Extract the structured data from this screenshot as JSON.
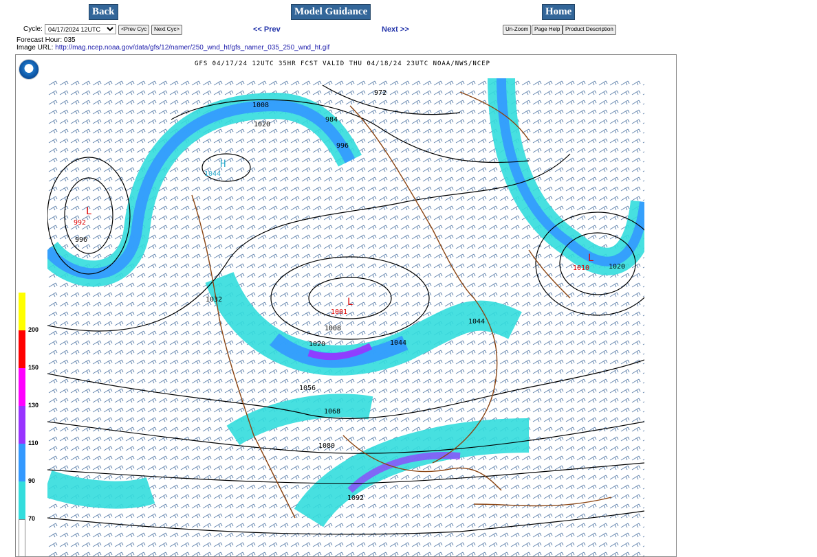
{
  "nav": {
    "back": "Back",
    "model_guidance": "Model Guidance",
    "home": "Home"
  },
  "cycle": {
    "label": "Cycle:",
    "value": "04/17/2024 12UTC",
    "prev_cyc": "<Prev Cyc",
    "next_cyc": "Next Cyc>"
  },
  "links": {
    "prev": "<< Prev",
    "next": "Next >>"
  },
  "tools": {
    "unzoom": "Un-Zoom",
    "page_help": "Page Help",
    "product_description": "Product Description"
  },
  "info": {
    "forecast_hour": "Forecast Hour: 035",
    "image_url_label": "Image URL:",
    "image_url": "http://mag.ncep.noaa.gov/data/gfs/12/namer/250_wnd_ht/gfs_namer_035_250_wnd_ht.gif"
  },
  "map": {
    "title": "GFS 04/17/24 12UTC 35HR FCST VALID THU 04/18/24 23UTC NOAA/NWS/NCEP",
    "legend": [
      "200",
      "150",
      "130",
      "110",
      "90",
      "70"
    ],
    "legend_colors": [
      "#ffff00",
      "#ff0000",
      "#ff00ff",
      "#9933ff",
      "#3399ff",
      "#33dddd"
    ],
    "pressure_labels": {
      "low1": "L",
      "low1_val": "992",
      "low2": "L",
      "low2_val": "1001",
      "low3": "L",
      "low3_val": "1010",
      "high1": "H",
      "high1_val": "1044",
      "c972": "972",
      "c984": "984",
      "c996a": "996",
      "c996b": "996",
      "c1008a": "1008",
      "c1008b": "1008",
      "c1020a": "1020",
      "c1020b": "1020",
      "c1020c": "1020",
      "c1032": "1032",
      "c1044a": "1044",
      "c1044b": "1044",
      "c1056": "1056",
      "c1068": "1068",
      "c1080": "1080",
      "c1092": "1092"
    }
  }
}
